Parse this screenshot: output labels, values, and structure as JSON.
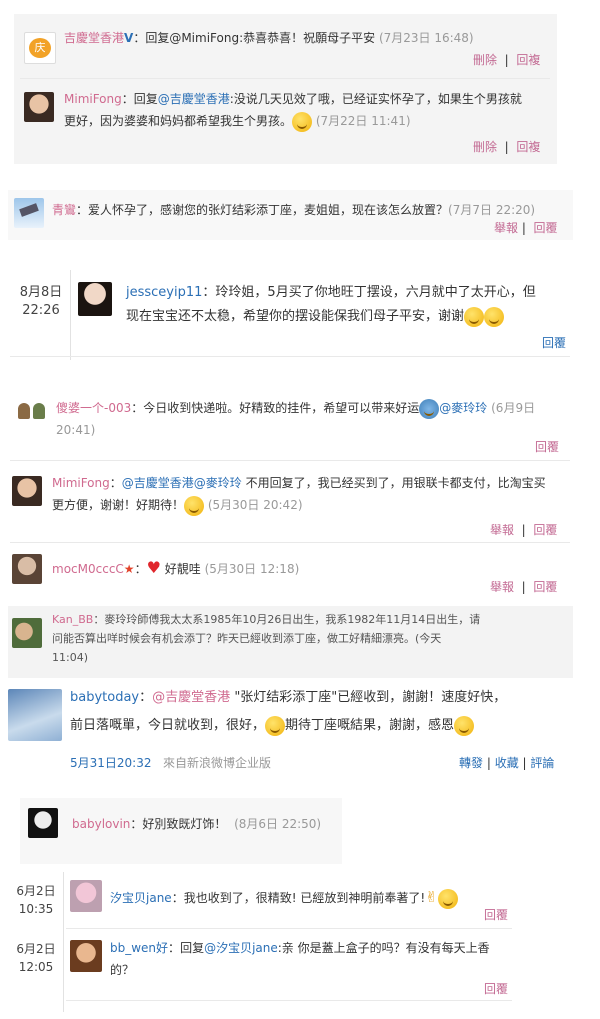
{
  "c1": {
    "user": "吉慶堂香港",
    "badge": "V",
    "sep": "：",
    "text": "回复@MimiFong:恭喜恭喜！祝願母子平安",
    "time": "(7月23日 16:48)",
    "del": "刪除",
    "reply": "回複"
  },
  "c2": {
    "user": "MimiFong",
    "sep": "：",
    "reply_to": "回复",
    "mention": "@吉慶堂香港",
    "text1": ":没说几天见效了哦，已经证实怀孕了，如果生个男孩就",
    "text2": "更好，因为婆婆和妈妈都希望我生个男孩。",
    "time": "(7月22日 11:41)",
    "del": "刪除",
    "reply": "回複"
  },
  "c3": {
    "user": "青鸞",
    "sep": "：",
    "text": "爱人怀孕了，感谢您的张灯结彩添丁座，麦姐姐，现在该怎么放置？",
    "time": "(7月7日 22:20)",
    "report": "舉報",
    "reply": "回覆"
  },
  "c4": {
    "date1": "8月8日",
    "date2": "22:26",
    "user": "jessceyip11",
    "sep": "：",
    "text1": "玲玲姐，5月买了你地旺丁摆设，六月就中了太开心，但",
    "text2": "现在宝宝还不太稳，希望你的摆设能保我们母子平安，谢谢",
    "reply": "回覆"
  },
  "c5": {
    "user": "傻婆一个-003",
    "sep": "：",
    "text": "今日收到快递啦。好精致的挂件，希望可以带来好运",
    "mention": "@麥玲玲",
    "time1": "(6月9日",
    "time2": "20:41)",
    "reply": "回覆"
  },
  "c6": {
    "user": "MimiFong",
    "sep": "：",
    "mention": "@吉慶堂香港@麥玲玲",
    "text1": "不用回复了，我已经买到了，用银联卡都支付，比淘宝买",
    "text2": "更方便，谢谢！好期待！",
    "time": "(5月30日 20:42)",
    "report": "舉報",
    "reply": "回覆"
  },
  "c7": {
    "user": "mocM0cccC",
    "sep": "：",
    "text": "好靚哇",
    "time": "(5月30日 12:18)",
    "report": "舉報",
    "reply": "回覆"
  },
  "c8": {
    "user": "Kan_BB",
    "sep": "：",
    "text1": "麥玲玲師傅我太太系1985年10月26日出生，我系1982年11月14日出生，请",
    "text2": "问能否算出咩时候会有机会添丁？昨天已經收到添丁座，做工好精細漂亮。(今天",
    "text3": "11:04)"
  },
  "c9": {
    "user": "babytoday",
    "sep": "：",
    "mention": "@吉慶堂香港",
    "text1": "\"张灯结彩添丁座\"已經收到，謝謝！速度好快，",
    "text2": "前日落嘅單，今日就收到，很好，",
    "text2b": "期待丁座嘅結果，謝謝，感恩",
    "time": "5月31日20:32",
    "source": "來自新浪微博企业版",
    "forward": "轉發",
    "fav": "收藏",
    "comment": "評論"
  },
  "c10": {
    "user": "babylovin",
    "sep": "：",
    "text": "好別致既灯饰！",
    "time": "(8月6日 22:50)"
  },
  "c11": {
    "date1": "6月2日",
    "date2": "10:35",
    "user": "汐宝贝jane",
    "sep": "：",
    "text": "我也收到了，很精致! 已經放到神明前奉著了!",
    "reply": "回覆"
  },
  "c12": {
    "date1": "6月2日",
    "date2": "12:05",
    "user": "bb_wen好",
    "sep": "：",
    "reply_to": "回复",
    "mention": "@汐宝贝jane",
    "text1": ":亲 你是蓋上盒子的吗？有没有每天上香",
    "text2": "的？",
    "reply": "回覆"
  }
}
